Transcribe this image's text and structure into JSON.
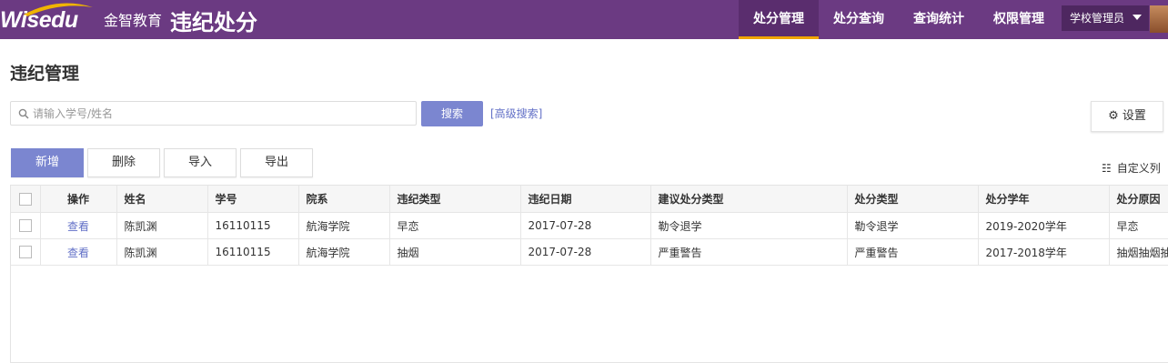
{
  "brand": {
    "logo_en": "Wisedu",
    "logo_cn": "金智教育",
    "app_title": "违纪处分"
  },
  "nav": [
    {
      "label": "处分管理",
      "active": true
    },
    {
      "label": "处分查询",
      "active": false
    },
    {
      "label": "查询统计",
      "active": false
    },
    {
      "label": "权限管理",
      "active": false
    }
  ],
  "user": {
    "role": "学校管理员"
  },
  "page": {
    "title": "违纪管理"
  },
  "search": {
    "placeholder": "请输入学号/姓名",
    "button": "搜索",
    "advanced": "[高级搜索]"
  },
  "settings": {
    "label": "设置"
  },
  "actions": {
    "add": "新增",
    "delete": "删除",
    "import": "导入",
    "export": "导出"
  },
  "custom_columns": "自定义列",
  "table": {
    "headers": [
      "操作",
      "姓名",
      "学号",
      "院系",
      "违纪类型",
      "违纪日期",
      "建议处分类型",
      "处分类型",
      "处分学年",
      "处分原因"
    ],
    "rows": [
      {
        "action": "查看",
        "name": "陈凯渊",
        "id": "16110115",
        "dept": "航海学院",
        "type": "早恋",
        "date": "2017-07-28",
        "suggest": "勒令退学",
        "punish": "勒令退学",
        "year": "2019-2020学年",
        "reason": "早恋"
      },
      {
        "action": "查看",
        "name": "陈凯渊",
        "id": "16110115",
        "dept": "航海学院",
        "type": "抽烟",
        "date": "2017-07-28",
        "suggest": "严重警告",
        "punish": "严重警告",
        "year": "2017-2018学年",
        "reason": "抽烟抽烟抽"
      }
    ]
  },
  "colors": {
    "topbar": "#6b3a82",
    "accent": "#7b86d0",
    "nav_active_underline": "#f0a500",
    "link": "#6270c7"
  }
}
